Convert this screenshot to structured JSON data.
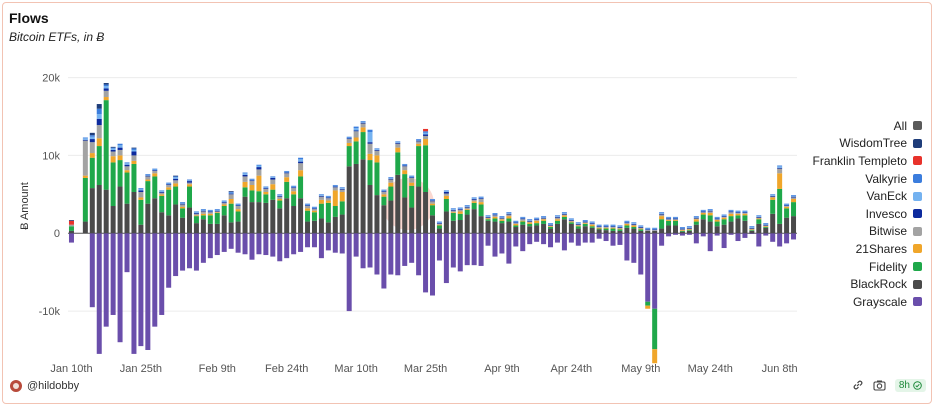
{
  "header": {
    "title": "Flows",
    "subtitle": "Bitcoin ETFs, in Ƀ"
  },
  "footer": {
    "user": "@hildobby",
    "age": "8h"
  },
  "legend_items": [
    {
      "label": "All",
      "color": "#5a5a5a"
    },
    {
      "label": "WisdomTree",
      "color": "#1f3d7a"
    },
    {
      "label": "Franklin Templeto",
      "color": "#e8322b"
    },
    {
      "label": "Valkyrie",
      "color": "#3b7ddd"
    },
    {
      "label": "VanEck",
      "color": "#74b2f0"
    },
    {
      "label": "Invesco",
      "color": "#0d2a9e"
    },
    {
      "label": "Bitwise",
      "color": "#a3a3a3"
    },
    {
      "label": "21Shares",
      "color": "#f0a62a"
    },
    {
      "label": "Fidelity",
      "color": "#1fa84a"
    },
    {
      "label": "BlackRock",
      "color": "#4a4a4a"
    },
    {
      "label": "Grayscale",
      "color": "#6a4eab"
    }
  ],
  "chart_data": {
    "type": "bar",
    "stacked": true,
    "title": "Flows",
    "subtitle": "Bitcoin ETFs, in Ƀ",
    "ylabel": "Ƀ Amount",
    "xlabel": "",
    "ylim": [
      -15000,
      22000
    ],
    "yticks": [
      {
        "v": 20000,
        "label": "20k"
      },
      {
        "v": 10000,
        "label": "10k"
      },
      {
        "v": 0,
        "label": "0"
      },
      {
        "v": -10000,
        "label": "-10k"
      }
    ],
    "xticks": [
      {
        "label": "Jan 10th",
        "i": 0
      },
      {
        "label": "Jan 25th",
        "i": 10
      },
      {
        "label": "Feb 9th",
        "i": 21
      },
      {
        "label": "Feb 24th",
        "i": 31
      },
      {
        "label": "Mar 10th",
        "i": 41
      },
      {
        "label": "Mar 25th",
        "i": 51
      },
      {
        "label": "Apr 9th",
        "i": 62
      },
      {
        "label": "Apr 24th",
        "i": 72
      },
      {
        "label": "May 9th",
        "i": 82
      },
      {
        "label": "May 24th",
        "i": 92
      },
      {
        "label": "Jun 8th",
        "i": 102
      }
    ],
    "grid": true,
    "legend_position": "right",
    "series": [
      {
        "name": "Grayscale",
        "color": "#6a4eab",
        "values": [
          -1200,
          0,
          0,
          -9500,
          -15500,
          -12000,
          -10500,
          -14000,
          -5000,
          -15500,
          -14500,
          -15000,
          -12000,
          -10500,
          -7000,
          -5500,
          -4800,
          -4500,
          -4800,
          -3800,
          -3200,
          -2800,
          -2400,
          -2000,
          -2500,
          -2700,
          -3400,
          -2700,
          -2800,
          -3000,
          -3600,
          -3200,
          -2700,
          -2400,
          -1800,
          -1800,
          -3200,
          -2200,
          -2500,
          -2600,
          -10000,
          -3000,
          -4500,
          -4400,
          -5300,
          -7100,
          -5300,
          -5400,
          -4200,
          -3800,
          -5400,
          -7600,
          -8000,
          -3500,
          -6400,
          -4400,
          -4900,
          -4100,
          -4100,
          -4200,
          -1600,
          -3000,
          -2600,
          -3900,
          -1700,
          -2300,
          -1400,
          -1100,
          -1400,
          -1800,
          -1200,
          -2200,
          -1200,
          -1600,
          -1200,
          -1200,
          -700,
          -1000,
          -1600,
          -1500,
          -3500,
          -3800,
          -5300,
          -8800,
          -9700,
          -1600,
          -400,
          -200,
          -300,
          -200,
          -1300,
          -400,
          -2300,
          -300,
          -1900,
          -200,
          -1000,
          -600,
          -100,
          -1700,
          -300,
          -1100,
          -1700,
          -1300,
          -800
        ]
      },
      {
        "name": "BlackRock",
        "color": "#4a4a4a",
        "values": [
          300,
          0,
          1500,
          5800,
          6200,
          5600,
          3500,
          6000,
          3800,
          5300,
          1100,
          3800,
          4500,
          2700,
          2300,
          3700,
          2000,
          3300,
          1300,
          1800,
          1200,
          1200,
          2300,
          1400,
          1500,
          4700,
          4000,
          4000,
          3900,
          4300,
          3200,
          4500,
          3500,
          4500,
          1500,
          1600,
          1900,
          1400,
          2100,
          2400,
          8600,
          8900,
          9500,
          6200,
          4900,
          3600,
          4200,
          7500,
          4600,
          3300,
          6000,
          5300,
          2300,
          600,
          2800,
          1600,
          1700,
          2400,
          3100,
          2200,
          1600,
          1500,
          1300,
          1500,
          800,
          1100,
          900,
          1000,
          1200,
          600,
          1200,
          1800,
          1200,
          600,
          900,
          700,
          500,
          400,
          300,
          300,
          700,
          600,
          300,
          300,
          300,
          600,
          1000,
          1000,
          200,
          300,
          1100,
          1800,
          1500,
          900,
          1100,
          1500,
          1900,
          1600,
          300,
          1200,
          700,
          2500,
          1200,
          2000,
          2200
        ]
      },
      {
        "name": "Fidelity",
        "color": "#1fa84a",
        "values": [
          600,
          0,
          5600,
          3900,
          5000,
          11500,
          5600,
          3400,
          4000,
          3600,
          3200,
          2900,
          2800,
          2100,
          3300,
          2300,
          1200,
          2700,
          900,
          500,
          1100,
          1400,
          1200,
          2400,
          1300,
          1200,
          1500,
          1400,
          1100,
          1300,
          1000,
          2100,
          1500,
          2800,
          1400,
          1100,
          1900,
          2500,
          1400,
          1700,
          2600,
          2900,
          3500,
          3200,
          4200,
          1100,
          1800,
          2900,
          3000,
          2800,
          5200,
          6000,
          1300,
          400,
          1600,
          1000,
          800,
          600,
          800,
          1500,
          200,
          400,
          300,
          400,
          200,
          400,
          300,
          300,
          400,
          200,
          400,
          300,
          200,
          300,
          300,
          200,
          100,
          200,
          300,
          200,
          300,
          200,
          200,
          -500,
          -5200,
          1200,
          600,
          600,
          100,
          100,
          400,
          600,
          800,
          600,
          700,
          700,
          400,
          700,
          100,
          600,
          100,
          1800,
          4500,
          1200,
          1800
        ]
      },
      {
        "name": "21Shares",
        "color": "#f0a62a",
        "values": [
          0,
          0,
          300,
          600,
          1000,
          400,
          800,
          600,
          300,
          400,
          300,
          200,
          400,
          200,
          300,
          400,
          200,
          300,
          100,
          200,
          200,
          100,
          200,
          600,
          300,
          700,
          700,
          2000,
          300,
          700,
          200,
          600,
          400,
          800,
          300,
          200,
          500,
          300,
          2000,
          1200,
          400,
          500,
          600,
          800,
          900,
          300,
          500,
          600,
          500,
          400,
          300,
          800,
          200,
          100,
          400,
          100,
          300,
          100,
          200,
          300,
          100,
          200,
          200,
          300,
          200,
          100,
          200,
          300,
          200,
          100,
          200,
          200,
          100,
          100,
          100,
          200,
          100,
          100,
          100,
          100,
          200,
          200,
          100,
          -400,
          -1800,
          400,
          100,
          100,
          100,
          100,
          300,
          200,
          300,
          200,
          200,
          300,
          200,
          200,
          100,
          100,
          100,
          300,
          2000,
          200,
          400
        ]
      },
      {
        "name": "Bitwise",
        "color": "#a3a3a3",
        "values": [
          200,
          0,
          4500,
          1400,
          1700,
          800,
          600,
          700,
          500,
          700,
          700,
          400,
          300,
          200,
          300,
          400,
          300,
          200,
          200,
          300,
          200,
          100,
          200,
          600,
          400,
          700,
          500,
          800,
          400,
          600,
          300,
          500,
          400,
          900,
          300,
          200,
          400,
          300,
          400,
          300,
          500,
          800,
          500,
          1300,
          600,
          300,
          400,
          500,
          500,
          600,
          300,
          400,
          300,
          100,
          300,
          200,
          200,
          200,
          200,
          400,
          100,
          200,
          100,
          200,
          100,
          200,
          100,
          100,
          100,
          100,
          200,
          100,
          100,
          100,
          100,
          100,
          100,
          100,
          100,
          100,
          100,
          100,
          100,
          100,
          100,
          200,
          100,
          100,
          100,
          100,
          100,
          100,
          200,
          100,
          100,
          200,
          100,
          100,
          100,
          100,
          100,
          100,
          600,
          100,
          200
        ]
      },
      {
        "name": "Invesco",
        "color": "#0d2a9e",
        "values": [
          0,
          0,
          100,
          400,
          800,
          300,
          200,
          300,
          200,
          500,
          200,
          100,
          100,
          100,
          100,
          200,
          100,
          200,
          100,
          100,
          100,
          100,
          100,
          100,
          100,
          200,
          100,
          300,
          100,
          200,
          100,
          100,
          100,
          200,
          100,
          100,
          100,
          100,
          100,
          100,
          100,
          100,
          100,
          200,
          100,
          100,
          100,
          100,
          100,
          100,
          100,
          200,
          100,
          100,
          200,
          100,
          100,
          100,
          100,
          100,
          100,
          100,
          100,
          100,
          100,
          100,
          100,
          100,
          100,
          100,
          100,
          100,
          100,
          100,
          100,
          100,
          100,
          100,
          100,
          100,
          100,
          100,
          100,
          100,
          100,
          100,
          100,
          100,
          100,
          100,
          100,
          100,
          100,
          100,
          100,
          100,
          100,
          100,
          100,
          100,
          100,
          100,
          100,
          100,
          100
        ]
      },
      {
        "name": "VanEck",
        "color": "#74b2f0",
        "values": [
          0,
          0,
          200,
          300,
          600,
          300,
          200,
          300,
          200,
          200,
          200,
          100,
          100,
          100,
          100,
          200,
          100,
          100,
          100,
          100,
          100,
          100,
          100,
          100,
          100,
          200,
          100,
          200,
          100,
          100,
          100,
          100,
          100,
          300,
          100,
          100,
          100,
          100,
          100,
          100,
          100,
          300,
          100,
          1300,
          100,
          100,
          100,
          100,
          100,
          100,
          100,
          200,
          100,
          100,
          100,
          100,
          100,
          100,
          100,
          100,
          100,
          100,
          100,
          100,
          100,
          100,
          100,
          100,
          100,
          100,
          100,
          100,
          100,
          100,
          100,
          100,
          100,
          100,
          100,
          100,
          100,
          100,
          100,
          100,
          100,
          100,
          100,
          100,
          100,
          100,
          100,
          100,
          100,
          100,
          100,
          100,
          100,
          100,
          100,
          100,
          100,
          100,
          200,
          100,
          100
        ]
      },
      {
        "name": "Valkyrie",
        "color": "#3b7ddd",
        "values": [
          0,
          0,
          100,
          200,
          700,
          200,
          100,
          200,
          100,
          200,
          100,
          100,
          100,
          100,
          100,
          100,
          100,
          100,
          100,
          100,
          100,
          100,
          100,
          100,
          100,
          100,
          100,
          100,
          100,
          100,
          100,
          100,
          100,
          200,
          100,
          100,
          100,
          100,
          100,
          100,
          100,
          200,
          100,
          300,
          100,
          100,
          100,
          100,
          100,
          100,
          100,
          200,
          100,
          100,
          100,
          100,
          100,
          100,
          100,
          100,
          100,
          100,
          100,
          100,
          100,
          100,
          100,
          100,
          100,
          100,
          100,
          100,
          100,
          100,
          100,
          100,
          100,
          100,
          100,
          100,
          100,
          100,
          100,
          100,
          100,
          100,
          100,
          100,
          100,
          100,
          100,
          100,
          100,
          100,
          100,
          100,
          100,
          100,
          100,
          100,
          100,
          100,
          100,
          100,
          100
        ]
      },
      {
        "name": "Franklin Templeto",
        "color": "#e8322b",
        "values": [
          500,
          0,
          0,
          0,
          0,
          0,
          0,
          0,
          0,
          0,
          0,
          0,
          0,
          0,
          0,
          0,
          0,
          0,
          0,
          0,
          0,
          0,
          0,
          0,
          0,
          0,
          0,
          0,
          0,
          0,
          0,
          0,
          0,
          0,
          0,
          0,
          0,
          0,
          0,
          0,
          0,
          0,
          0,
          0,
          0,
          0,
          0,
          0,
          0,
          0,
          0,
          300,
          0,
          0,
          0,
          0,
          0,
          0,
          0,
          0,
          0,
          0,
          0,
          0,
          0,
          0,
          0,
          0,
          0,
          0,
          0,
          0,
          0,
          0,
          0,
          0,
          0,
          0,
          0,
          0,
          0,
          0,
          0,
          0,
          0,
          0,
          0,
          0,
          0,
          0,
          0,
          0,
          0,
          0,
          0,
          0,
          0,
          0,
          0,
          0,
          0,
          0,
          0,
          0,
          0
        ]
      },
      {
        "name": "WisdomTree",
        "color": "#1f3d7a",
        "values": [
          100,
          0,
          0,
          300,
          600,
          200,
          100,
          0,
          0,
          100,
          0,
          0,
          0,
          0,
          0,
          100,
          0,
          0,
          0,
          0,
          0,
          0,
          0,
          100,
          0,
          0,
          0,
          0,
          0,
          0,
          0,
          0,
          0,
          0,
          0,
          0,
          0,
          0,
          0,
          0,
          0,
          0,
          0,
          0,
          0,
          0,
          0,
          0,
          0,
          0,
          0,
          0,
          0,
          0,
          0,
          0,
          0,
          0,
          0,
          0,
          0,
          0,
          0,
          0,
          0,
          0,
          0,
          0,
          0,
          0,
          0,
          0,
          0,
          0,
          0,
          0,
          0,
          0,
          0,
          0,
          0,
          0,
          0,
          0,
          0,
          0,
          0,
          0,
          0,
          0,
          0,
          0,
          0,
          0,
          0,
          0,
          0,
          0,
          0,
          0,
          0,
          0,
          0,
          0,
          0
        ]
      }
    ]
  }
}
